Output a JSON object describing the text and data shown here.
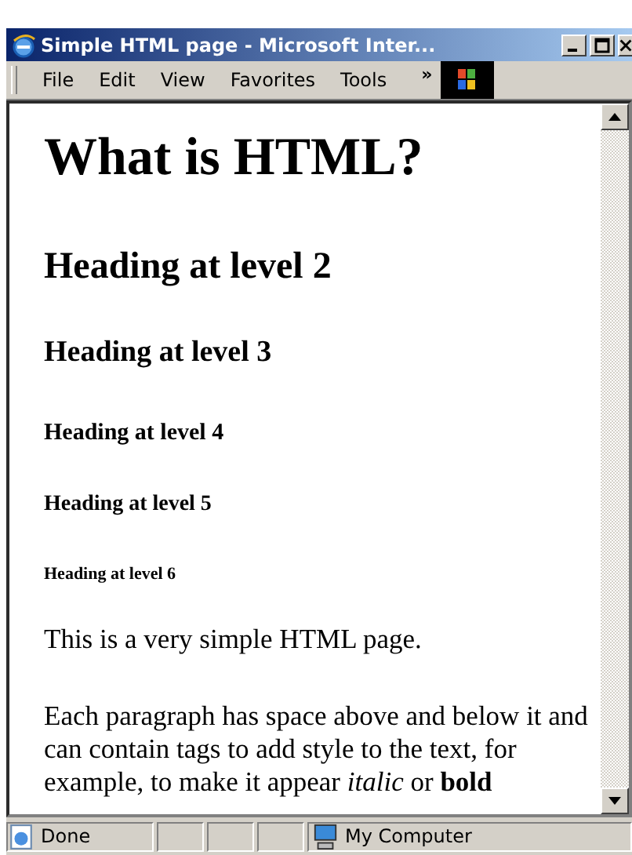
{
  "window": {
    "title": "Simple HTML page - Microsoft Inter..."
  },
  "menu": [
    "File",
    "Edit",
    "View",
    "Favorites",
    "Tools"
  ],
  "menu_overflow": "»",
  "content": [
    {
      "kind": "h1",
      "text": "What is HTML?"
    },
    {
      "kind": "h2",
      "text": "Heading at level 2"
    },
    {
      "kind": "h3",
      "text": "Heading at level 3"
    },
    {
      "kind": "h4",
      "text": "Heading at level 4"
    },
    {
      "kind": "h5",
      "text": "Heading at level 5"
    },
    {
      "kind": "h6",
      "text": "Heading at level 6"
    },
    {
      "kind": "p",
      "text": "This is a very simple HTML page."
    },
    {
      "kind": "p",
      "text": "Each paragraph has space above and below it and can contain tags to add style to the text, for example, to make it appear *italic* or **bold**"
    }
  ],
  "status_bar": {
    "status": "Done",
    "zone": "My Computer"
  }
}
